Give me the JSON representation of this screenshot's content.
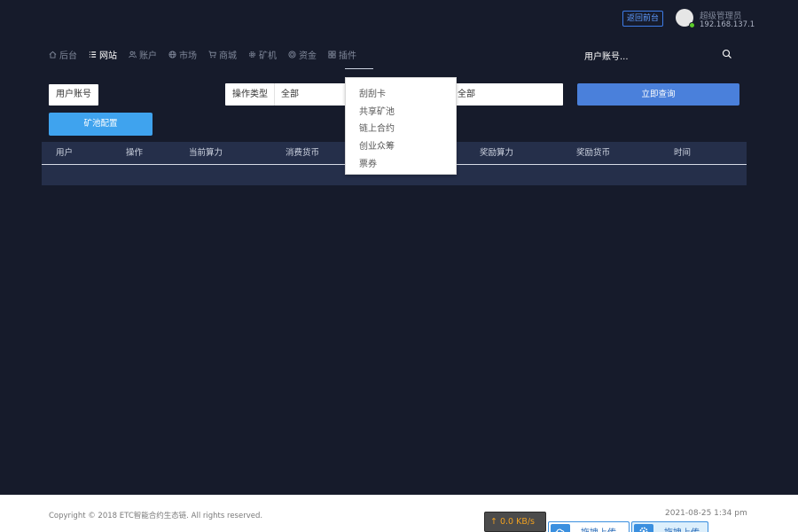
{
  "header": {
    "back_button": "返回前台",
    "user_role": "超级管理员",
    "user_ip": "192.168.137.1"
  },
  "nav": {
    "items": [
      {
        "label": "后台",
        "icon": "home-icon"
      },
      {
        "label": "网站",
        "icon": "list-icon"
      },
      {
        "label": "账户",
        "icon": "users-icon"
      },
      {
        "label": "市场",
        "icon": "globe-icon"
      },
      {
        "label": "商城",
        "icon": "cart-icon"
      },
      {
        "label": "矿机",
        "icon": "gear-icon"
      },
      {
        "label": "资金",
        "icon": "coin-icon"
      },
      {
        "label": "插件",
        "icon": "grid-icon"
      }
    ],
    "active_index": 1
  },
  "search": {
    "placeholder": "用户账号..."
  },
  "filters": {
    "user_field": "用户账号",
    "op_type_label": "操作类型",
    "op_type_value": "全部",
    "second_value": "全部",
    "query_button": "立即查询",
    "pool_config_button": "矿池配置"
  },
  "table": {
    "columns": [
      "用户",
      "操作",
      "当前算力",
      "消费货币",
      "奖励算力",
      "奖励货币",
      "时间"
    ]
  },
  "plugin_dropdown": {
    "items": [
      "刮刮卡",
      "共享矿池",
      "链上合约",
      "创业众筹",
      "票券"
    ]
  },
  "footer": {
    "copyright": "Copyright © 2018 ETC智能合约生态链. All rights reserved.",
    "datetime": "2021-08-25 1:34 pm",
    "speed": "↑ 0.0 KB/s",
    "upload_a": "拖拽上传",
    "upload_b": "拖拽上传"
  },
  "colors": {
    "background": "#161b2b",
    "table_bg": "#252f4a",
    "query_button": "#4a80db",
    "pool_button": "#3fa3ee",
    "status_online": "#5bcb2b"
  }
}
